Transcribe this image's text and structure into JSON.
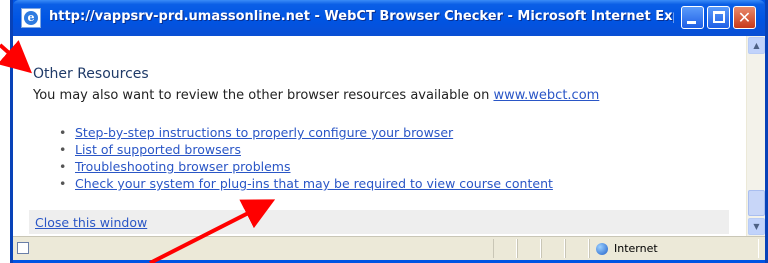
{
  "window": {
    "title": "http://vappsrv-prd.umassonline.net - WebCT Browser Checker - Microsoft Internet Explorer ..."
  },
  "content": {
    "heading": "Other Resources",
    "intro_prefix": "You may also want to review the other browser resources available on ",
    "intro_link": "www.webct.com",
    "links": [
      "Step-by-step instructions to properly configure your browser",
      "List of supported browsers",
      "Troubleshooting browser problems",
      "Check your system for plug-ins that may be required to view course content"
    ],
    "close_link": "Close this window"
  },
  "statusbar": {
    "zone": "Internet"
  },
  "colors": {
    "titlebar": "#0054e3",
    "link": "#2a56c6",
    "heading": "#1f3a68",
    "annotation_arrow": "#ff0000"
  },
  "icons": {
    "window": "ie-page-icon",
    "minimize": "minimize-icon",
    "maximize": "maximize-icon",
    "close": "close-icon",
    "zone": "globe-icon",
    "status": "page-icon"
  }
}
